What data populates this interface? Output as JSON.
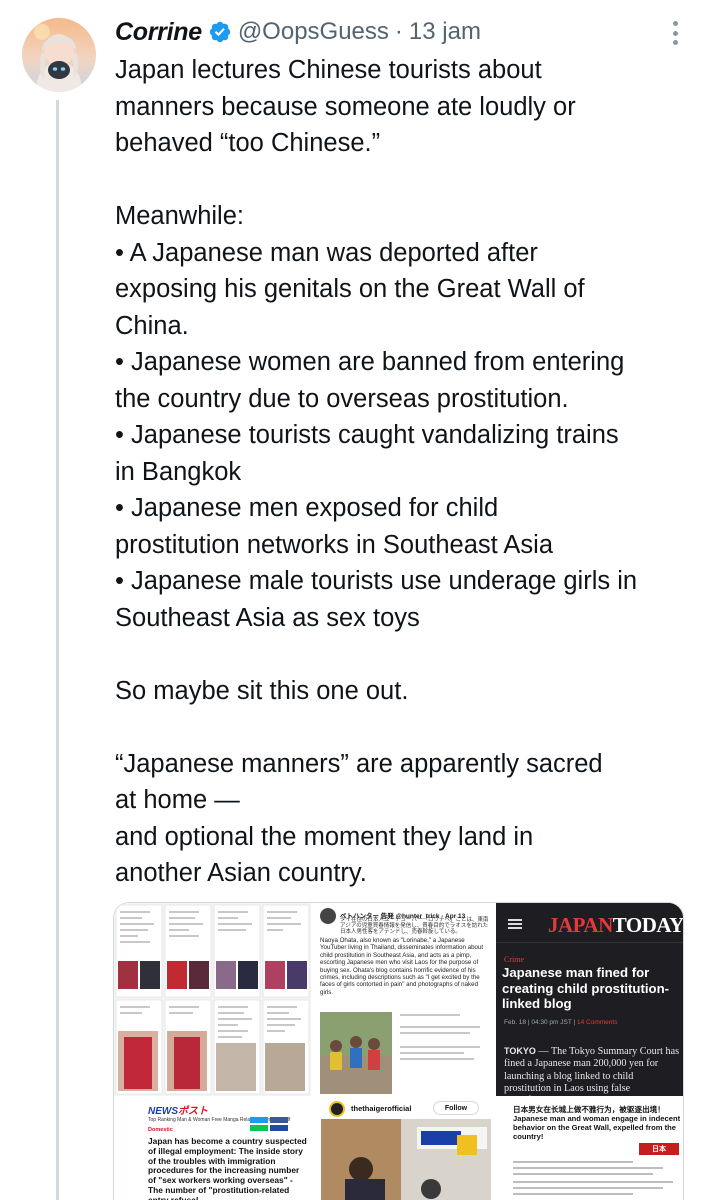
{
  "tweet": {
    "display_name": "Corrine",
    "handle": "@OopsGuess",
    "separator": "·",
    "time": "13 jam",
    "verified": true,
    "text_lines": [
      "Japan lectures Chinese tourists about",
      "manners because someone ate loudly or",
      "behaved “too Chinese.”",
      "",
      "Meanwhile:",
      "• A Japanese man was deported after",
      "exposing his genitals on the Great Wall of",
      "China.",
      "• Japanese women are banned from entering",
      "the country due to overseas prostitution.",
      "• Japanese tourists caught vandalizing trains",
      "in Bangkok",
      "• Japanese men exposed for child",
      "prostitution networks in Southeast Asia",
      "• Japanese male tourists use underage girls in",
      "Southeast Asia as sex toys",
      "",
      "So maybe sit this one out.",
      "",
      "“Japanese manners” are apparently sacred",
      "at home —",
      "and optional the moment they land in",
      "another Asian country."
    ]
  },
  "media": {
    "japantoday": {
      "logo_red": "JAPAN",
      "logo_white": "TODAY",
      "category": "Crime",
      "headline": "Japanese man fined for creating child prostitution-linked blog",
      "date": "Feb. 18 | 04:30 pm JST |",
      "comments": "14 Comments",
      "dateline": "TOKYO",
      "body": " — The Tokyo Summary Court has fined a Japanese man 200,000 yen for launching a blog linked to child prostitution in Laos using false identification."
    },
    "news_post": {
      "name": "ベトハンター 告発 @hunter_trick · Apr 13",
      "jp_text": "タイ在住の日本人ユーチューバー「ロリナベ」ことは、東南アジアの児童買春情報を発信し、買春目的でラオスを訪れた日本人男性客をアテンドし、売春斡旋している。",
      "body": "Naoya Ohata, also known as \"Lorinabe,\" a Japanese YouTuber living in Thailand, disseminates information about child prostitution in Southeast Asia, and acts as a pimp, escorting Japanese men who visit Laos for the purpose of buying sex. Ohata's blog contains horrific evidence of his crimes, including descriptions such as \"I get excited by the faces of girls contorted in pain\" and photographs of naked girls."
    },
    "article": {
      "logo_a": "NEWS",
      "logo_b": "ポスト",
      "nav": "Top   Ranking   Man & Woman   Free Manga   Related News   Yourself",
      "category": "Domestic",
      "headline": "Japan has become a country suspected of illegal employment: The inside story of the troubles with immigration procedures for the increasing number of \"sex workers working overseas\" - The number of \"prostitution-related entry refusal"
    },
    "thaiger": {
      "name": "thethaigerofficial",
      "follow": "Follow"
    },
    "great_wall": {
      "jp_title": "日本男女在长城上做不雅行为，被驱逐出境！",
      "en_title": "Japanese man and woman engage in indecent behavior on the Great Wall, expelled from the country!",
      "badge": "日本"
    }
  },
  "colors": {
    "text": "#0f1419",
    "muted": "#536471",
    "verified": "#1d9bf0",
    "japantoday_red": "#e23a3a",
    "thread_line": "#cfd9de"
  }
}
